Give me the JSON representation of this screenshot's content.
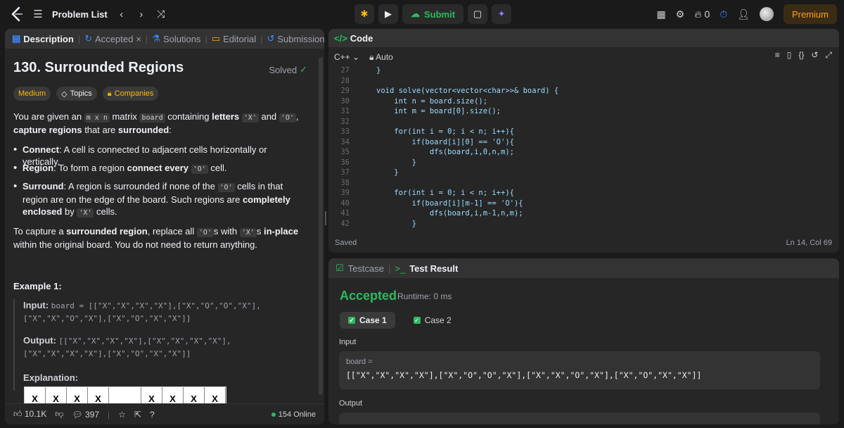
{
  "topbar": {
    "problem_list": "Problem List",
    "submit": "Submit",
    "streak": "0",
    "premium": "Premium"
  },
  "left_tabs": [
    {
      "label": "Description"
    },
    {
      "label": "Accepted"
    },
    {
      "label": "Solutions"
    },
    {
      "label": "Editorial"
    },
    {
      "label": "Submissions"
    }
  ],
  "problem": {
    "title": "130. Surrounded Regions",
    "status": "Solved",
    "difficulty": "Medium",
    "topics": "Topics",
    "companies": "Companies",
    "intro_a": "You are given an",
    "intro_mxn": "m x n",
    "intro_b": "matrix",
    "intro_board": "board",
    "intro_c": "containing",
    "intro_letters": "letters",
    "intro_x": "'X'",
    "intro_and": "and",
    "intro_o": "'O'",
    "intro_comma": ",",
    "intro_capture": "capture",
    "intro_regions": "regions",
    "intro_d": "that are",
    "intro_surrounded": "surrounded",
    "intro_colon": ":",
    "b1_term": "Connect",
    "b1_text": ": A cell is connected to adjacent cells horizontally or vertically.",
    "b2_term": "Region",
    "b2_text": ": To form a region",
    "b2_bold": "connect every",
    "b2_code": "'O'",
    "b2_end": "cell.",
    "b3_term": "Surround",
    "b3_text_a": ": A region is surrounded if none of the",
    "b3_code": "'O'",
    "b3_text_b": "cells in that region are on the edge of the board. Such regions are",
    "b3_bold": "completely enclosed",
    "b3_by": "by",
    "b3_code2": "'X'",
    "b3_end": "cells.",
    "cap_a": "To capture a",
    "cap_bold": "surrounded region",
    "cap_b": ", replace all",
    "cap_code1": "'O'",
    "cap_c": "s with",
    "cap_code2": "'X'",
    "cap_d": "s",
    "cap_bold2": "in-place",
    "cap_e": "within the original board. You do not need to return anything.",
    "example_title": "Example 1:",
    "input_label": "Input:",
    "input_value": "board = [[\"X\",\"X\",\"X\",\"X\"],[\"X\",\"O\",\"O\",\"X\"],[\"X\",\"X\",\"O\",\"X\"],[\"X\",\"O\",\"X\",\"X\"]]",
    "output_label": "Output:",
    "output_value": "[[\"X\",\"X\",\"X\",\"X\"],[\"X\",\"X\",\"X\",\"X\"],[\"X\",\"X\",\"X\",\"X\"],[\"X\",\"O\",\"X\",\"X\"]]",
    "explanation_label": "Explanation:",
    "grid_cells": [
      "X",
      "X",
      "X",
      "X",
      "",
      "X",
      "X",
      "X",
      "X"
    ]
  },
  "left_footer": {
    "likes": "10.1K",
    "comments": "397",
    "online": "154 Online"
  },
  "code": {
    "header": "Code",
    "language": "C++",
    "auto": "Auto",
    "saved": "Saved",
    "cursor": "Ln 14, Col 69",
    "lines": [
      {
        "n": "27",
        "t": "}"
      },
      {
        "n": "28",
        "t": ""
      },
      {
        "n": "29",
        "t": "void solve(vector<vector<char>>& board) {"
      },
      {
        "n": "30",
        "t": "    int n = board.size();"
      },
      {
        "n": "31",
        "t": "    int m = board[0].size();"
      },
      {
        "n": "32",
        "t": ""
      },
      {
        "n": "33",
        "t": "    for(int i = 0; i < n; i++){"
      },
      {
        "n": "34",
        "t": "        if(board[i][0] == 'O'){"
      },
      {
        "n": "35",
        "t": "            dfs(board,i,0,n,m);"
      },
      {
        "n": "36",
        "t": "        }"
      },
      {
        "n": "37",
        "t": "    }"
      },
      {
        "n": "38",
        "t": ""
      },
      {
        "n": "39",
        "t": "    for(int i = 0; i < n; i++){"
      },
      {
        "n": "40",
        "t": "        if(board[i][m-1] == 'O'){"
      },
      {
        "n": "41",
        "t": "            dfs(board,i,m-1,n,m);"
      },
      {
        "n": "42",
        "t": "        }"
      }
    ]
  },
  "test": {
    "testcase_tab": "Testcase",
    "result_tab": "Test Result",
    "verdict": "Accepted",
    "runtime": "Runtime: 0 ms",
    "case1": "Case 1",
    "case2": "Case 2",
    "input_label": "Input",
    "var_name": "board =",
    "input_value": "[[\"X\",\"X\",\"X\",\"X\"],[\"X\",\"O\",\"O\",\"X\"],[\"X\",\"X\",\"O\",\"X\"],[\"X\",\"O\",\"X\",\"X\"]]",
    "output_label": "Output"
  }
}
